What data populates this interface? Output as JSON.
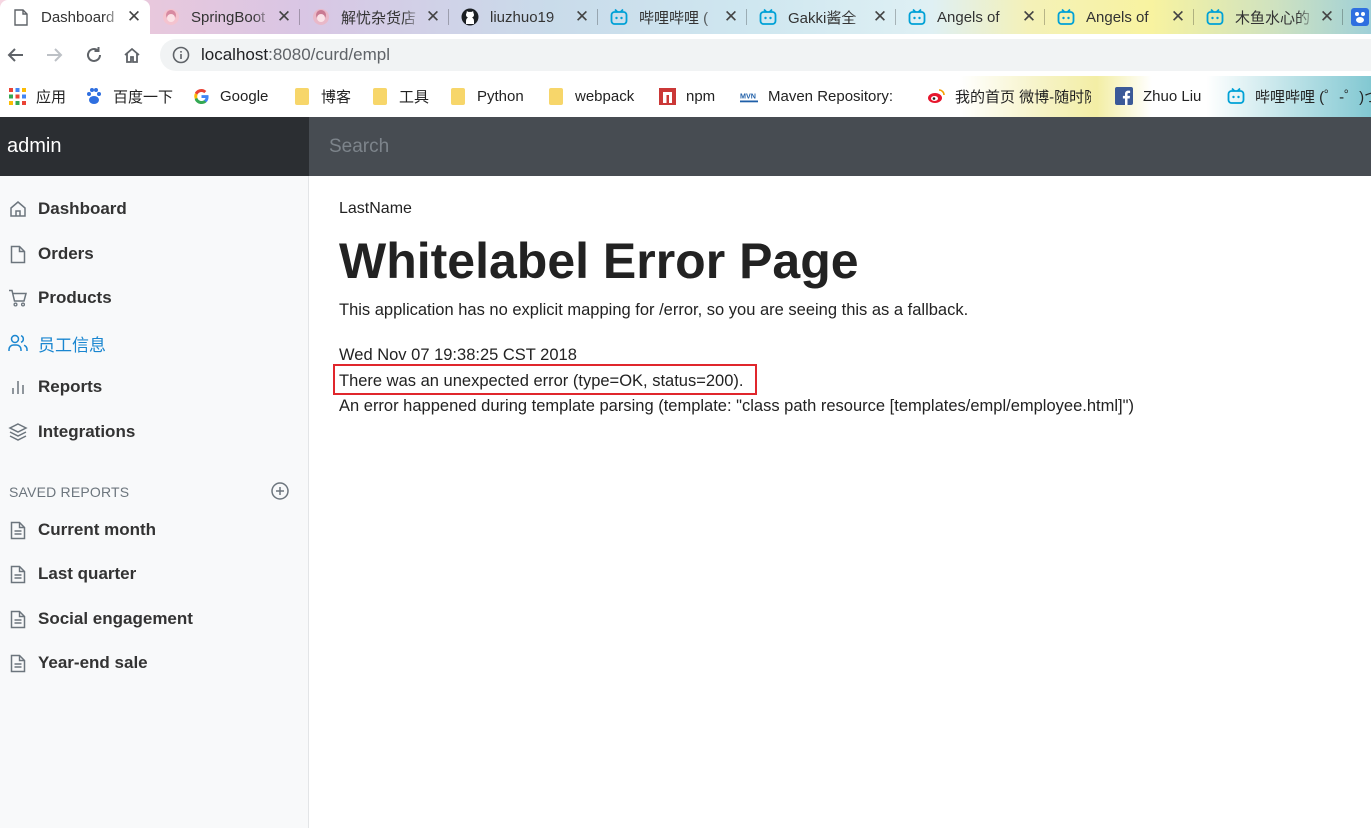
{
  "browser": {
    "tabs": [
      {
        "title": "Dashboard",
        "icon": "document-icon",
        "active": true
      },
      {
        "title": "SpringBoot",
        "icon": "anime-avatar-icon"
      },
      {
        "title": "解忧杂货店",
        "icon": "anime-avatar-icon"
      },
      {
        "title": "liuzhuo19",
        "icon": "github-icon"
      },
      {
        "title": "哔哩哔哩 (",
        "icon": "bilibili-icon"
      },
      {
        "title": "Gakki酱全",
        "icon": "bilibili-icon"
      },
      {
        "title": "Angels of",
        "icon": "bilibili-icon"
      },
      {
        "title": "Angels of",
        "icon": "bilibili-icon"
      },
      {
        "title": "木鱼水心的",
        "icon": "bilibili-icon"
      }
    ],
    "close_glyph": "✕",
    "url_host": "localhost",
    "url_path": ":8080/curd/empl",
    "bookmarks": [
      {
        "label": "应用",
        "icon": "apps-grid-icon"
      },
      {
        "label": "百度一下",
        "icon": "baidu-icon"
      },
      {
        "label": "Google",
        "icon": "google-icon"
      },
      {
        "label": "博客",
        "icon": "folder-icon"
      },
      {
        "label": "工具",
        "icon": "folder-icon"
      },
      {
        "label": "Python",
        "icon": "folder-icon"
      },
      {
        "label": "webpack",
        "icon": "folder-icon"
      },
      {
        "label": "npm",
        "icon": "npm-icon"
      },
      {
        "label": "Maven Repository: ",
        "icon": "maven-icon"
      },
      {
        "label": "我的首页 微博-随时随",
        "icon": "weibo-icon"
      },
      {
        "label": "Zhuo Liu",
        "icon": "facebook-icon"
      },
      {
        "label": "哔哩哔哩 (゜-゜)つ",
        "icon": "bilibili-icon"
      }
    ],
    "accent": "#1a73e8"
  },
  "app": {
    "brand": "admin",
    "search_placeholder": "Search",
    "nav": [
      {
        "label": "Dashboard",
        "icon": "home-icon"
      },
      {
        "label": "Orders",
        "icon": "file-icon"
      },
      {
        "label": "Products",
        "icon": "shopping-cart-icon"
      },
      {
        "label": "员工信息",
        "icon": "users-icon",
        "active": true
      },
      {
        "label": "Reports",
        "icon": "bar-chart-icon"
      },
      {
        "label": "Integrations",
        "icon": "layers-icon"
      }
    ],
    "saved_reports_heading": "SAVED REPORTS",
    "saved_reports": [
      {
        "label": "Current month",
        "icon": "file-text-icon"
      },
      {
        "label": "Last quarter",
        "icon": "file-text-icon"
      },
      {
        "label": "Social engagement",
        "icon": "file-text-icon"
      },
      {
        "label": "Year-end sale",
        "icon": "file-text-icon"
      }
    ],
    "active_color": "#1a86d0"
  },
  "main": {
    "column_label": "LastName",
    "error_title": "Whitelabel Error Page",
    "error_description": "This application has no explicit mapping for /error, so you are seeing this as a fallback.",
    "timestamp": "Wed Nov 07 19:38:25 CST 2018",
    "status_line": "There was an unexpected error (type=OK, status=200).",
    "detail": "An error happened during template parsing (template: \"class path resource [templates/empl/employee.html]\")",
    "highlight_color": "#e0262c"
  }
}
